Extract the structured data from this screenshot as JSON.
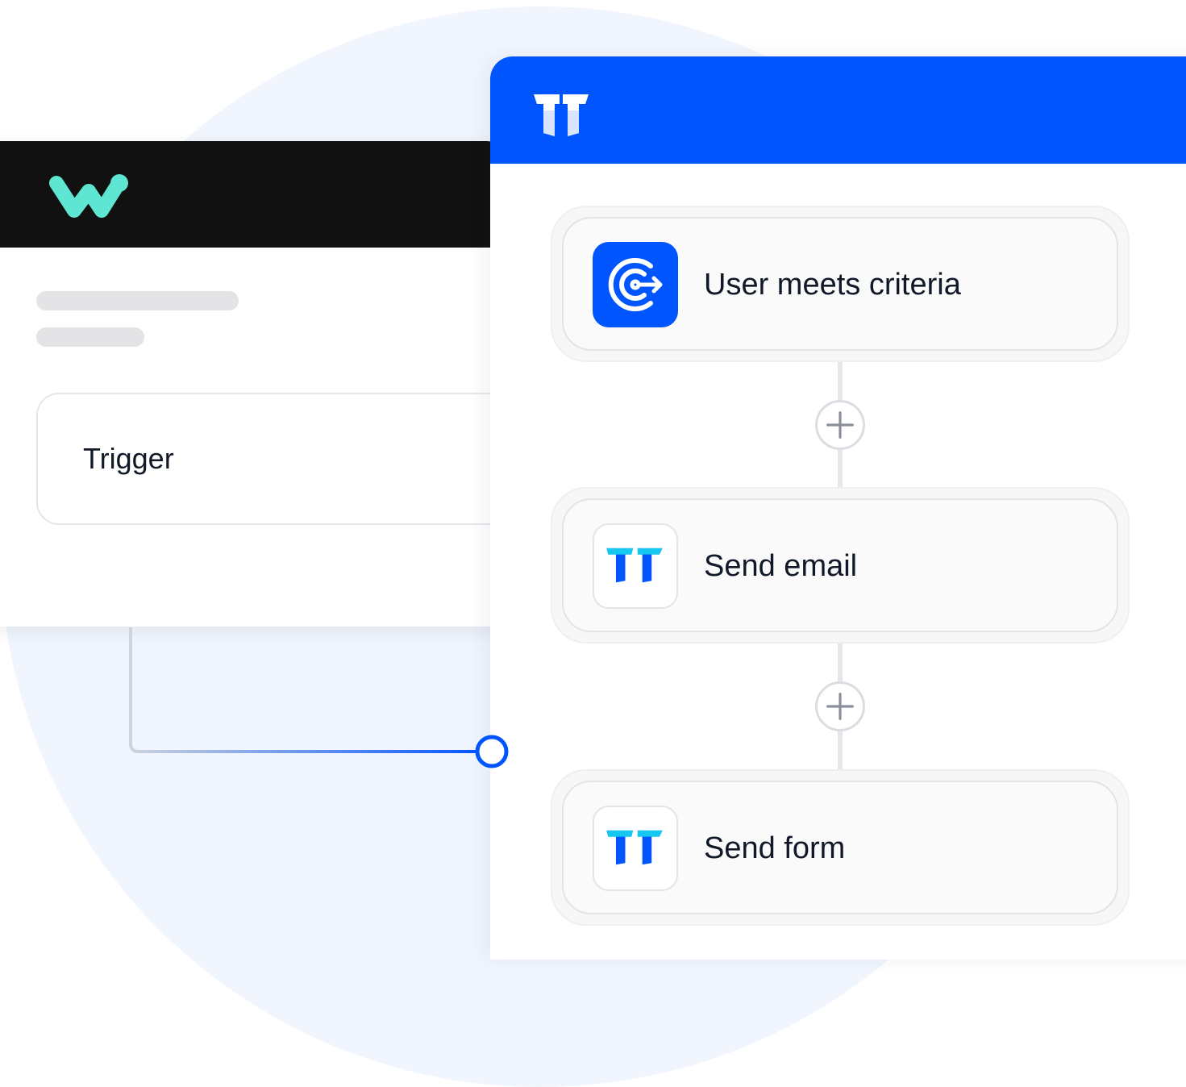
{
  "left_app": {
    "logo_icon": "webhook-w-logo",
    "header_color": "#111111",
    "logo_color": "#5fe6d2",
    "trigger_label": "Trigger"
  },
  "right_app": {
    "logo_icon": "typeform-t-logo",
    "header_color": "#0055ff",
    "steps": [
      {
        "label": "User meets criteria",
        "icon": "target-arrow-icon"
      },
      {
        "label": "Send email",
        "icon": "t-logo-icon"
      },
      {
        "label": "Send form",
        "icon": "t-logo-icon"
      }
    ],
    "add_step_icon": "plus-icon"
  },
  "connector_color": "#0055ff"
}
